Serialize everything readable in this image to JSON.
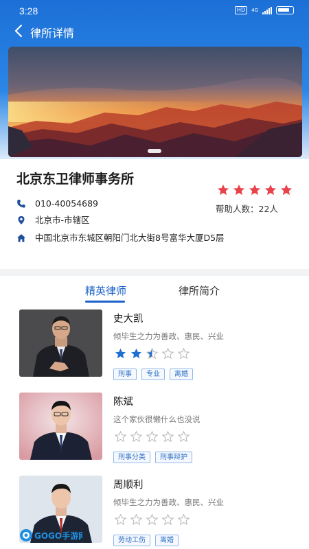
{
  "status_bar": {
    "time": "3:28",
    "network_badge": "HD",
    "signal_label": "4G"
  },
  "nav": {
    "title": "律所详情",
    "back_icon": "chevron-left-icon"
  },
  "banner": {
    "image": "mountain-sunset-photo",
    "slides_indicator": "dot-active"
  },
  "firm": {
    "name": "北京东卫律师事务所",
    "rating": 5,
    "rating_max": 5,
    "help_count_label": "帮助人数：22人",
    "phone": "010-40054689",
    "area": "北京市-市辖区",
    "address": "中国北京市东城区朝阳门北大街8号富华大厦D5层"
  },
  "tabs": [
    {
      "label": "精英律师",
      "active": true
    },
    {
      "label": "律所简介",
      "active": false
    }
  ],
  "lawyers": [
    {
      "name": "史大凯",
      "desc": "倾毕生之力为善政、惠民、兴业",
      "rating": 2.5,
      "tags": [
        "刑事",
        "专业",
        "离婚"
      ]
    },
    {
      "name": "陈斌",
      "desc": "这个家伙很懒什么也没说",
      "rating": 0,
      "tags": [
        "刑事分类",
        "刑事辩护"
      ]
    },
    {
      "name": "周顺利",
      "desc": "倾毕生之力为善政、惠民、兴业",
      "rating": 0,
      "tags": [
        "劳动工伤",
        "离婚"
      ]
    }
  ],
  "watermark": {
    "text": "GOGO手游网"
  },
  "colors": {
    "accent": "#1a62c8",
    "star_red": "#e8434b",
    "star_blue": "#1f6fd0",
    "header_blue": "#1c6fd6"
  }
}
